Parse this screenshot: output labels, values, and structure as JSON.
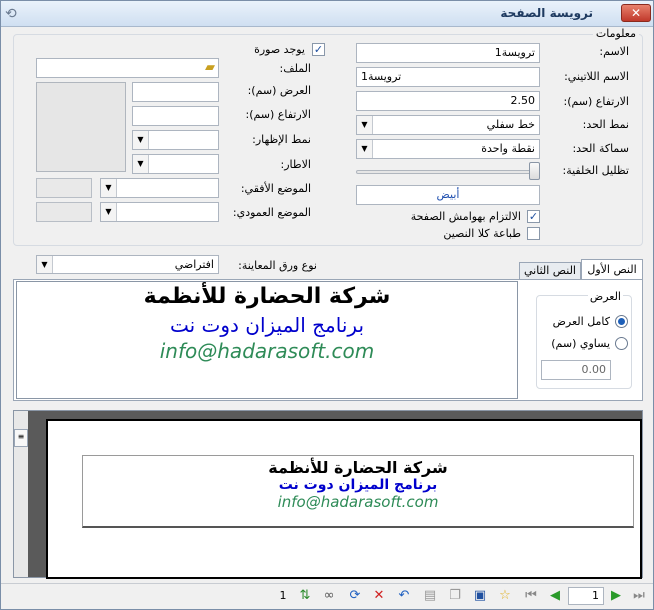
{
  "window": {
    "title": "ترويسة الصفحة"
  },
  "info_group": {
    "label": "معلومات"
  },
  "form": {
    "name_label": "الاسم:",
    "name_value": "ترويسة1",
    "latin_name_label": "الاسم اللاتيني:",
    "latin_name_value": "ترويسة1",
    "height_label": "الارتفاع (سم):",
    "height_value": "2.50",
    "border_style_label": "نمط الحد:",
    "border_style_value": "خط سفلي",
    "border_thickness_label": "سماكة الحد:",
    "border_thickness_value": "نقطة واحدة",
    "background_shading_label": "تظليل الخلفية:",
    "background_color_value": "أبيض",
    "margin_commit_label": "الالتزام بهوامش الصفحة",
    "margin_commit_checked": true,
    "print_both_label": "طباعة كلا النصين",
    "print_both_checked": false,
    "has_image_label": "يوجد صورة",
    "has_image_checked": true,
    "file_label": "الملف:",
    "width_label": "العرض (سم):",
    "img_height_label": "الارتفاع (سم):",
    "display_style_label": "نمط الإظهار:",
    "frame_label": "الاطار:",
    "h_position_label": "الموضع الأفقي:",
    "v_position_label": "الموضع العمودي:",
    "paper_type_label": "نوع ورق المعاينة:",
    "paper_type_value": "افتراضي"
  },
  "tabs": [
    {
      "label": "النص الأول"
    },
    {
      "label": "النص الثاني"
    }
  ],
  "width_group": {
    "label": "العرض",
    "full_width_label": "كامل العرض",
    "equal_label": "يساوي (سم)",
    "equal_value": "0.00",
    "selected": "full"
  },
  "text_editor": {
    "line1": "شركة الحضارة للأنظمة",
    "line2": "برنامج الميزان دوت نت",
    "line3": "info@hadarasoft.com",
    "line1_color": "#000000",
    "line2_color": "#0000cc",
    "line3_color": "#2e8b57"
  },
  "preview": {
    "line1": "شركة الحضارة للأنظمة",
    "line2": "برنامج الميزان دوت نت",
    "line3": "info@hadarasoft.com"
  },
  "toolbar": {
    "page_number": "1",
    "page_count": "1"
  },
  "icons": {
    "window": "window-icon",
    "close": "close-icon",
    "folder": "folder-icon",
    "first": "first-page-icon",
    "prev": "prev-page-icon",
    "next": "next-page-icon",
    "last": "last-page-icon",
    "star": "star-icon",
    "save": "save-icon",
    "copy": "copy-icon",
    "paste": "paste-icon",
    "undo": "undo-icon",
    "delete": "delete-icon",
    "refresh": "refresh-icon",
    "view": "view-icon",
    "sort": "sort-icon"
  }
}
